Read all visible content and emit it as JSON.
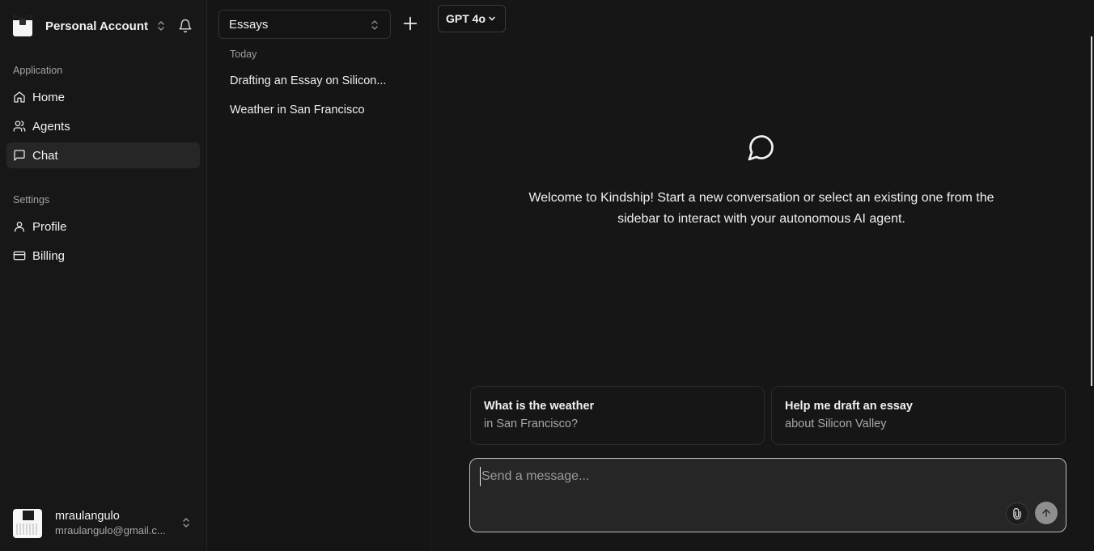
{
  "account": {
    "name": "Personal Account"
  },
  "nav": {
    "application_label": "Application",
    "items": [
      {
        "label": "Home",
        "icon": "home-icon"
      },
      {
        "label": "Agents",
        "icon": "users-icon"
      },
      {
        "label": "Chat",
        "icon": "message-icon",
        "active": true
      }
    ],
    "settings_label": "Settings",
    "settings_items": [
      {
        "label": "Profile",
        "icon": "user-icon"
      },
      {
        "label": "Billing",
        "icon": "credit-card-icon"
      }
    ]
  },
  "user": {
    "name": "mraulangulo",
    "email": "mraulangulo@gmail.c..."
  },
  "conversations": {
    "folder": "Essays",
    "group_label": "Today",
    "items": [
      {
        "title": "Drafting an Essay on Silicon..."
      },
      {
        "title": "Weather in San Francisco"
      }
    ]
  },
  "main": {
    "model": "GPT 4o",
    "welcome": "Welcome to Kindship! Start a new conversation or select an existing one from the sidebar to interact with your autonomous AI agent.",
    "suggestions": [
      {
        "title": "What is the weather",
        "subtitle": "in San Francisco?"
      },
      {
        "title": "Help me draft an essay",
        "subtitle": "about Silicon Valley"
      }
    ],
    "composer": {
      "placeholder": "Send a message...",
      "value": ""
    }
  },
  "colors": {
    "background": "#161616",
    "sidebar": "#171717",
    "active_item": "#262626",
    "composer": "#262626"
  }
}
